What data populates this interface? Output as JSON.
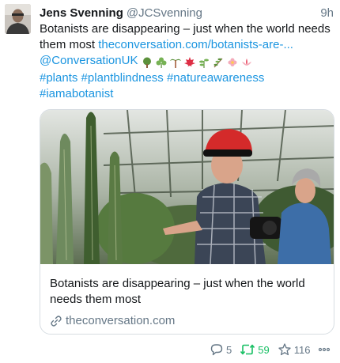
{
  "tweet": {
    "name": "Jens Svenning",
    "handle": "@JCSvenning",
    "time": "9h",
    "text_start": "Botanists are disappearing – just when the world needs them most ",
    "link_url": "theconversation.com/botanists-are-...",
    "mention": "@ConversationUK",
    "hashtags": [
      "#plants",
      "#plantblindness",
      "#natureawareness",
      "#iamabotanist"
    ]
  },
  "emojis": [
    "tree-emoji",
    "shamrock-emoji",
    "palm-tree-emoji",
    "maple-leaf-emoji",
    "herb-emoji",
    "seedling-branch-emoji",
    "flower-emoji",
    "lotus-emoji"
  ],
  "card": {
    "title": "Botanists are disappearing – just when the world needs them most",
    "domain": "theconversation.com"
  },
  "actions": {
    "replies": "5",
    "retweets": "59",
    "likes": "116"
  },
  "colors": {
    "link": "#1b95e0",
    "retweet_active": "#17bf63",
    "muted": "#657786"
  }
}
